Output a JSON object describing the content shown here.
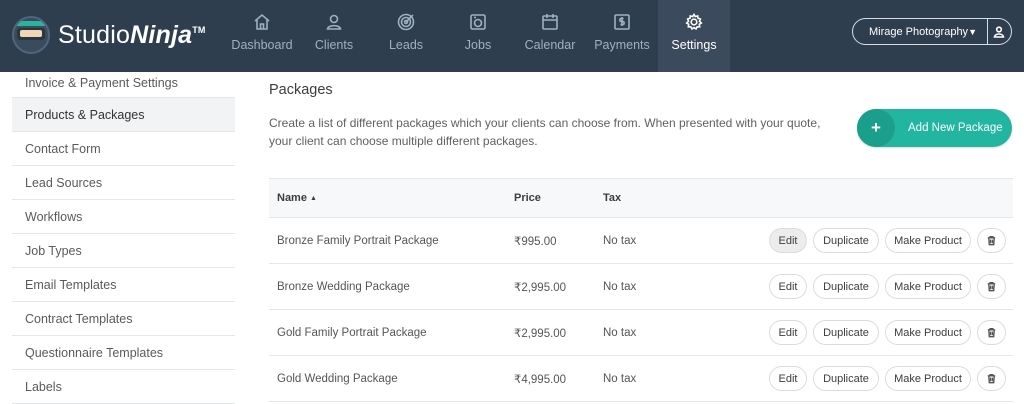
{
  "brand": {
    "name_light": "Studio",
    "name_bold": "Ninja",
    "trademark": "TM"
  },
  "nav": {
    "items": [
      {
        "label": "Dashboard",
        "icon": "home-icon"
      },
      {
        "label": "Clients",
        "icon": "users-icon"
      },
      {
        "label": "Leads",
        "icon": "target-icon"
      },
      {
        "label": "Jobs",
        "icon": "camera-icon"
      },
      {
        "label": "Calendar",
        "icon": "calendar-icon"
      },
      {
        "label": "Payments",
        "icon": "payment-icon"
      },
      {
        "label": "Settings",
        "icon": "gear-icon",
        "active": true
      }
    ]
  },
  "account": {
    "name": "Mirage Photography",
    "chevron": "⌄"
  },
  "sidebar": {
    "items": [
      {
        "label": "Invoice & Payment Settings"
      },
      {
        "label": "Products & Packages",
        "active": true
      },
      {
        "label": "Contact Form"
      },
      {
        "label": "Lead Sources"
      },
      {
        "label": "Workflows"
      },
      {
        "label": "Job Types"
      },
      {
        "label": "Email Templates"
      },
      {
        "label": "Contract Templates"
      },
      {
        "label": "Questionnaire Templates"
      },
      {
        "label": "Labels"
      }
    ]
  },
  "main": {
    "title": "Packages",
    "description": "Create a list of different packages which your clients can choose from. When presented with your quote, your client can choose multiple different packages.",
    "add_button": {
      "plus": "+",
      "label": "Add New Package"
    }
  },
  "table": {
    "columns": {
      "name": "Name",
      "sort_arrow": "▲",
      "price": "Price",
      "tax": "Tax"
    },
    "actions": {
      "edit": "Edit",
      "duplicate": "Duplicate",
      "make_product": "Make Product"
    },
    "rows": [
      {
        "name": "Bronze Family Portrait Package",
        "price": "₹995.00",
        "tax": "No tax"
      },
      {
        "name": "Bronze Wedding Package",
        "price": "₹2,995.00",
        "tax": "No tax"
      },
      {
        "name": "Gold Family Portrait Package",
        "price": "₹2,995.00",
        "tax": "No tax"
      },
      {
        "name": "Gold Wedding Package",
        "price": "₹4,995.00",
        "tax": "No tax"
      }
    ]
  },
  "colors": {
    "topbar": "#2f3e4e",
    "nav_active": "#3b4a5c",
    "accent": "#22b5a0"
  }
}
